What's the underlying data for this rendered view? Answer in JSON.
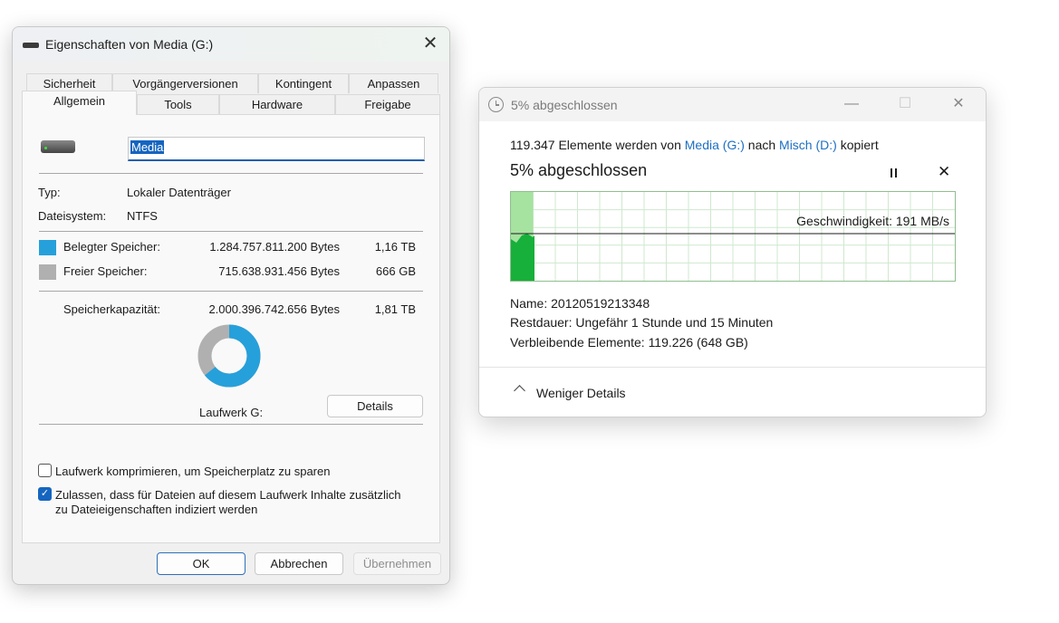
{
  "properties": {
    "title": "Eigenschaften von Media (G:)",
    "close": "✕",
    "tabs_row1": [
      "Sicherheit",
      "Vorgängerversionen",
      "Kontingent",
      "Anpassen"
    ],
    "tabs_row2": [
      "Allgemein",
      "Tools",
      "Hardware",
      "Freigabe"
    ],
    "active_tab": "Allgemein",
    "drive_name": "Media",
    "type_label": "Typ:",
    "type_value": "Lokaler Datenträger",
    "fs_label": "Dateisystem:",
    "fs_value": "NTFS",
    "used_label": "Belegter Speicher:",
    "used_bytes": "1.284.757.811.200 Bytes",
    "used_size": "1,16 TB",
    "free_label": "Freier Speicher:",
    "free_bytes": "715.638.931.456 Bytes",
    "free_size": "666 GB",
    "capacity_label": "Speicherkapazität:",
    "capacity_bytes": "2.000.396.742.656 Bytes",
    "capacity_size": "1,81 TB",
    "used_fraction": 0.642,
    "drive_label": "Laufwerk G:",
    "details_button": "Details",
    "compress_label": "Laufwerk komprimieren, um Speicherplatz zu sparen",
    "compress_checked": false,
    "index_label_1": "Zulassen, dass für Dateien auf diesem Laufwerk Inhalte zusätzlich",
    "index_label_2": "zu Dateieigenschaften indiziert werden",
    "index_checked": true,
    "ok": "OK",
    "cancel": "Abbrechen",
    "apply": "Übernehmen",
    "colors": {
      "used": "#26a0da",
      "free": "#b0b0b0"
    }
  },
  "copy": {
    "title": "5% abgeschlossen",
    "summary_prefix": "119.347 Elemente werden von",
    "source": "Media (G:)",
    "summary_mid": "nach",
    "dest": "Misch (D:)",
    "summary_suffix": "kopiert",
    "progress_heading": "5% abgeschlossen",
    "progress_fraction": 0.05,
    "speed": "Geschwindigkeit: 191 MB/s",
    "name_label": "Name:",
    "name_value": "20120519213348",
    "remaining_label": "Restdauer:",
    "remaining_value": "Ungefähr 1 Stunde und 15 Minuten",
    "items_label": "Verbleibende Elemente:",
    "items_value": "119.226 (648 GB)",
    "less_details": "Weniger Details",
    "min": "—",
    "max": "☐",
    "close": "✕"
  }
}
